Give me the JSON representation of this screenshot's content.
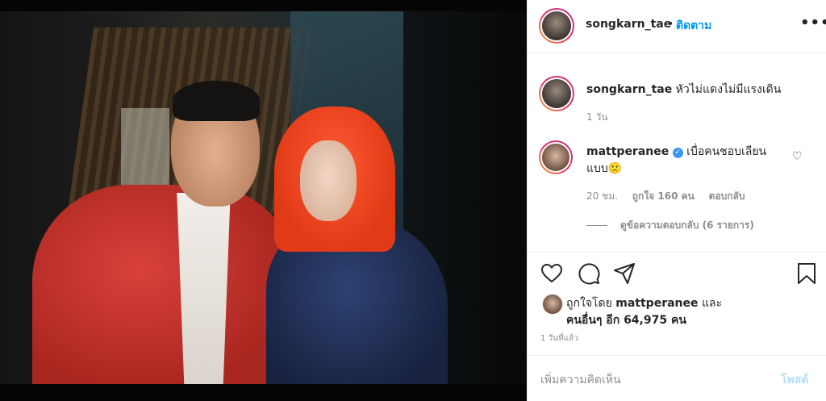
{
  "photo": {
    "alt": ""
  },
  "header": {
    "username": "songkarn_tae",
    "separator": "•",
    "follow_label": "ติดตาม",
    "more_icon": "more-options-icon",
    "more_glyph": "•••"
  },
  "caption": {
    "username": "songkarn_tae",
    "text": "หัวไม่แดงไม่มีแรงเดิน",
    "time": "1 วัน"
  },
  "comment": {
    "username": "mattperanee",
    "verified_glyph": "✓",
    "text": "เบื่อคนชอบเลียนแบบ",
    "emoji": "🙁",
    "time": "20 ชม.",
    "likes": "ถูกใจ 160 คน",
    "reply_label": "ตอบกลับ",
    "view_replies": "ดูข้อความตอบกลับ (6 รายการ)",
    "heart_glyph": "♡"
  },
  "actions": {
    "like_icon": "heart-icon",
    "comment_icon": "comment-icon",
    "share_icon": "share-icon",
    "save_icon": "bookmark-icon"
  },
  "likes": {
    "prefix": "ถูกใจโดย",
    "liker": "mattperanee",
    "suffix": "และ",
    "others": "คนอื่นๆ อีก 64,975 คน"
  },
  "posted_time": "1 วันที่แล้ว",
  "add_comment": {
    "placeholder": "เพิ่มความคิดเห็น",
    "post_label": "โพสต์"
  }
}
